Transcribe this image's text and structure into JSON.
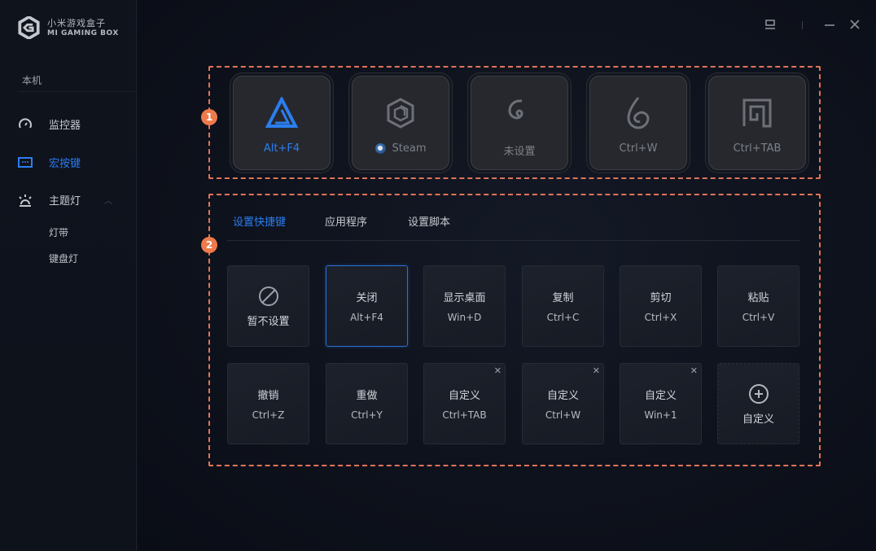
{
  "app": {
    "name_cn": "小米游戏盒子",
    "name_en": "MI GAMING BOX"
  },
  "window_controls": {
    "pin": "pin-icon",
    "minimize": "minimize-icon",
    "close": "close-icon"
  },
  "sidebar": {
    "section_label": "本机",
    "items": [
      {
        "label": "监控器",
        "icon": "gauge-icon",
        "active": false
      },
      {
        "label": "宏按键",
        "icon": "keyboard-icon",
        "active": true
      },
      {
        "label": "主题灯",
        "icon": "light-icon",
        "active": false,
        "expanded": true
      }
    ],
    "sub_items": [
      {
        "label": "灯带"
      },
      {
        "label": "键盘灯"
      }
    ]
  },
  "colors": {
    "accent": "#2b7ef0",
    "annotation": "#e0735a",
    "badge": "#ee7a4b"
  },
  "annotations": {
    "badge1": "1",
    "badge2": "2"
  },
  "macro_keys": [
    {
      "label": "Alt+F4",
      "icon": "triangle-logo-icon",
      "active": true
    },
    {
      "label": "Steam",
      "icon": "hexagon-icon",
      "app_icon": "steam-icon",
      "active": false
    },
    {
      "label": "未设置",
      "icon": "spiral-icon",
      "active": false
    },
    {
      "label": "Ctrl+W",
      "icon": "drop-spiral-icon",
      "active": false
    },
    {
      "label": "Ctrl+TAB",
      "icon": "square-spiral-icon",
      "active": false
    }
  ],
  "tabs": [
    {
      "label": "设置快捷键",
      "active": true
    },
    {
      "label": "应用程序",
      "active": false
    },
    {
      "label": "设置脚本",
      "active": false
    }
  ],
  "shortcuts": [
    {
      "title": "暂不设置",
      "sub": "",
      "icon": "prohibited-icon"
    },
    {
      "title": "关闭",
      "sub": "Alt+F4",
      "selected": true
    },
    {
      "title": "显示桌面",
      "sub": "Win+D"
    },
    {
      "title": "复制",
      "sub": "Ctrl+C"
    },
    {
      "title": "剪切",
      "sub": "Ctrl+X"
    },
    {
      "title": "粘贴",
      "sub": "Ctrl+V"
    },
    {
      "title": "撤销",
      "sub": "Ctrl+Z"
    },
    {
      "title": "重做",
      "sub": "Ctrl+Y"
    },
    {
      "title": "自定义",
      "sub": "Ctrl+TAB",
      "removable": true
    },
    {
      "title": "自定义",
      "sub": "Ctrl+W",
      "removable": true
    },
    {
      "title": "自定义",
      "sub": "Win+1",
      "removable": true
    },
    {
      "title": "自定义",
      "sub": "",
      "icon": "plus-circle-icon",
      "add": true
    }
  ],
  "close_glyph": "✕"
}
